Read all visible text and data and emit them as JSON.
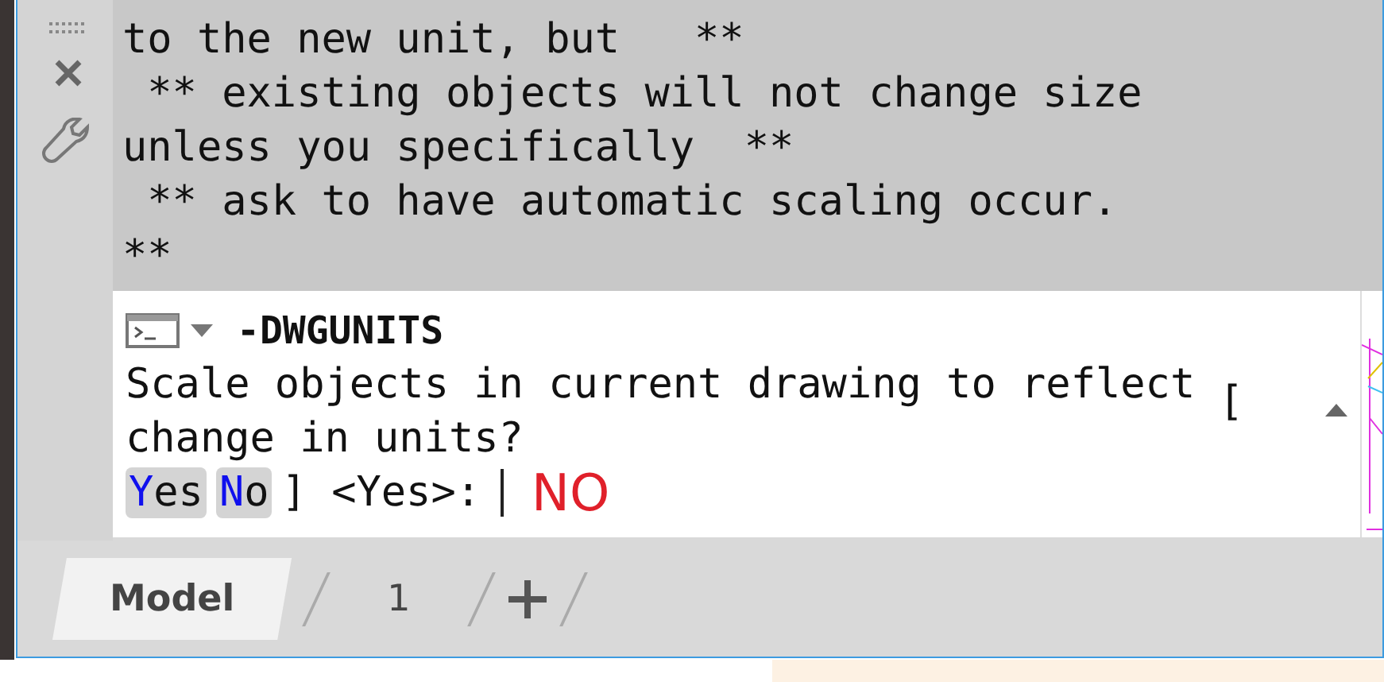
{
  "history": [
    "to the new unit, but   **",
    " ** existing objects will not change size",
    "unless you specifically  **",
    " ** ask to have automatic scaling occur.",
    "**"
  ],
  "command": {
    "name": "-DWGUNITS",
    "prompt_lines": [
      "Scale objects in current drawing to reflect",
      "change in units?"
    ],
    "bracket": "[",
    "options": [
      "Yes",
      "No"
    ],
    "suffix": "] <Yes>:",
    "input": "NO"
  },
  "tabs": [
    {
      "label": "Model",
      "selected": true
    },
    {
      "label": "1",
      "selected": false
    }
  ]
}
